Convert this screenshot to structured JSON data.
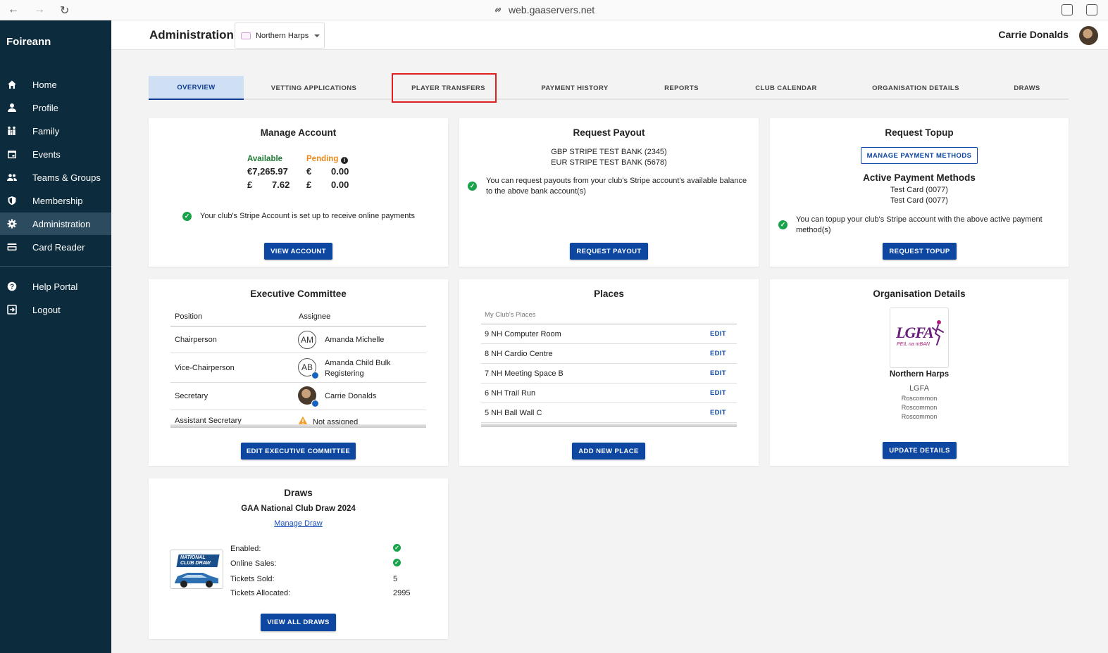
{
  "browser": {
    "url": "web.gaaservers.net"
  },
  "sidebar": {
    "brand": "Foireann",
    "items": [
      {
        "label": "Home",
        "icon": "home-icon"
      },
      {
        "label": "Profile",
        "icon": "person-icon"
      },
      {
        "label": "Family",
        "icon": "family-icon"
      },
      {
        "label": "Events",
        "icon": "calendar-icon"
      },
      {
        "label": "Teams & Groups",
        "icon": "group-icon"
      },
      {
        "label": "Membership",
        "icon": "shield-icon"
      },
      {
        "label": "Administration",
        "icon": "gear-icon",
        "active": true
      },
      {
        "label": "Card Reader",
        "icon": "card-icon"
      },
      {
        "label": "Help Portal",
        "icon": "help-icon"
      },
      {
        "label": "Logout",
        "icon": "logout-icon"
      }
    ]
  },
  "header": {
    "title": "Administration",
    "org_selector": "Northern Harps",
    "user_name": "Carrie Donalds"
  },
  "tabs": [
    {
      "label": "OVERVIEW",
      "active": true
    },
    {
      "label": "VETTING APPLICATIONS"
    },
    {
      "label": "PLAYER TRANSFERS",
      "highlighted": true
    },
    {
      "label": "PAYMENT HISTORY"
    },
    {
      "label": "REPORTS"
    },
    {
      "label": "CLUB CALENDAR"
    },
    {
      "label": "ORGANISATION DETAILS"
    },
    {
      "label": "DRAWS"
    }
  ],
  "manage_account": {
    "title": "Manage Account",
    "available_label": "Available",
    "pending_label": "Pending",
    "available_eur_symbol": "€7,265.97",
    "available_gbp_symbol": "£",
    "available_gbp": "7.62",
    "pending_eur_symbol": "€",
    "pending_eur": "0.00",
    "pending_gbp_symbol": "£",
    "pending_gbp": "0.00",
    "status_text": "Your club's Stripe Account is set up to receive online payments",
    "button": "VIEW ACCOUNT"
  },
  "request_payout": {
    "title": "Request Payout",
    "bank_1": "GBP STRIPE TEST BANK (2345)",
    "bank_2": "EUR STRIPE TEST BANK (5678)",
    "info_text": "You can request payouts from your club's Stripe account's available balance to the above bank account(s)",
    "button": "REQUEST PAYOUT"
  },
  "request_topup": {
    "title": "Request Topup",
    "manage_button": "MANAGE PAYMENT METHODS",
    "methods_title": "Active Payment Methods",
    "method_1": "Test Card (0077)",
    "method_2": "Test Card (0077)",
    "info_text": "You can topup your club's Stripe account with the above active payment method(s)",
    "button": "REQUEST TOPUP"
  },
  "executive_committee": {
    "title": "Executive Committee",
    "col_position": "Position",
    "col_assignee": "Assignee",
    "rows": [
      {
        "position": "Chairperson",
        "initials": "AM",
        "assignee": "Amanda Michelle"
      },
      {
        "position": "Vice-Chairperson",
        "initials": "AB",
        "assignee": "Amanda Child Bulk Registering"
      },
      {
        "position": "Secretary",
        "initials": "",
        "assignee": "Carrie Donalds"
      },
      {
        "position": "Assistant Secretary",
        "initials": "",
        "assignee": "Not assigned"
      }
    ],
    "button": "EDIT EXECUTIVE COMMITTEE"
  },
  "places": {
    "title": "Places",
    "subheader": "My Club's Places",
    "edit_label": "EDIT",
    "rows": [
      {
        "name": "9 NH Computer Room"
      },
      {
        "name": "8 NH Cardio Centre"
      },
      {
        "name": "7 NH Meeting Space B"
      },
      {
        "name": "6 NH Trail Run"
      },
      {
        "name": "5 NH Ball Wall C"
      }
    ],
    "button": "ADD NEW PLACE"
  },
  "organisation_details": {
    "title": "Organisation Details",
    "logo_text": "LGFA",
    "logo_subtext": "PEIL na mBAN",
    "name": "Northern Harps",
    "body": "LGFA",
    "line_1": "Roscommon",
    "line_2": "Roscommon",
    "line_3": "Roscommon",
    "button": "UPDATE DETAILS"
  },
  "draws": {
    "title": "Draws",
    "draw_name": "GAA National Club Draw 2024",
    "manage_link": "Manage Draw",
    "logo_text_1": "NATIONAL",
    "logo_text_2": "CLUB DRAW",
    "enabled_label": "Enabled:",
    "online_sales_label": "Online Sales:",
    "tickets_sold_label": "Tickets Sold:",
    "tickets_sold": "5",
    "tickets_allocated_label": "Tickets Allocated:",
    "tickets_allocated": "2995",
    "button": "VIEW ALL DRAWS"
  },
  "colors": {
    "sidebar": "#0c2b3c",
    "primary": "#0d47a1",
    "success": "#17a34a",
    "pending": "#e8891c",
    "available": "#1e7b34"
  }
}
